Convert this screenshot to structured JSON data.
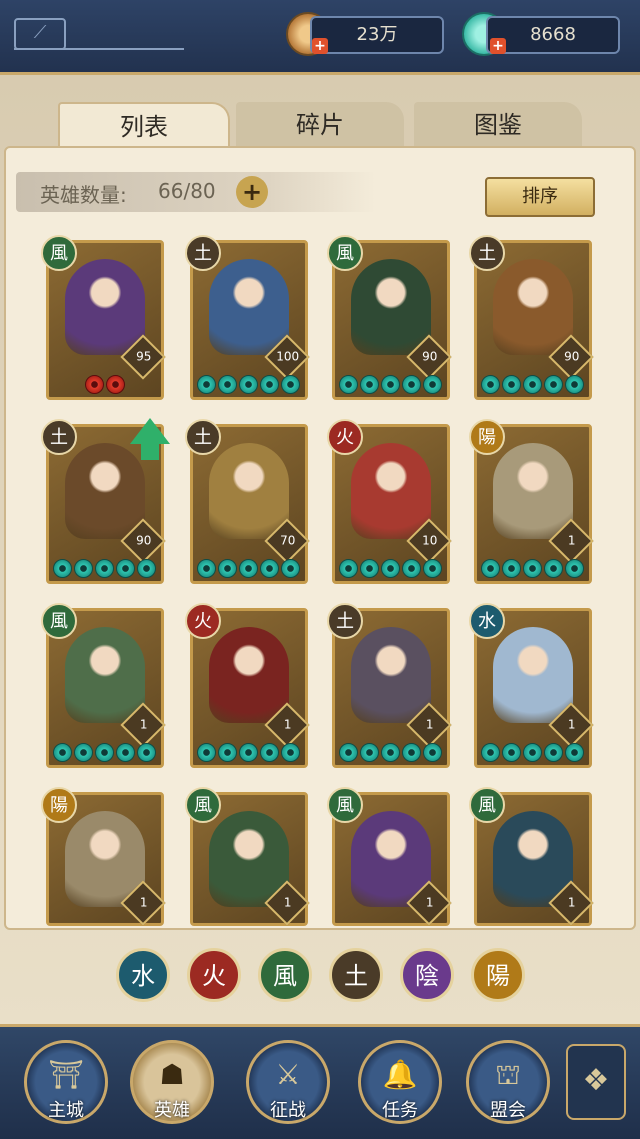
{
  "currency": {
    "coins": "23万",
    "gems": "8668"
  },
  "tabs": [
    {
      "label": "列表"
    },
    {
      "label": "碎片"
    },
    {
      "label": "图鉴"
    }
  ],
  "hero_count": {
    "label": "英雄数量:",
    "value": "66/80"
  },
  "sort_label": "排序",
  "elements": {
    "water": "水",
    "fire": "火",
    "wind": "風",
    "earth": "土",
    "yin": "陰",
    "yang": "陽"
  },
  "colors": {
    "water": "#1d5b6e",
    "fire": "#9c2a22",
    "wind": "#2f6a3b",
    "earth": "#4a3b28",
    "yin": "#6a3a8c",
    "yang": "#b07a18"
  },
  "heroes": [
    {
      "element": "風",
      "level": "95",
      "stars": 2,
      "red": true
    },
    {
      "element": "土",
      "level": "100",
      "stars": 5,
      "red": false
    },
    {
      "element": "風",
      "level": "90",
      "stars": 5,
      "red": false
    },
    {
      "element": "土",
      "level": "90",
      "stars": 5,
      "red": false
    },
    {
      "element": "土",
      "level": "90",
      "stars": 5,
      "red": false
    },
    {
      "element": "土",
      "level": "70",
      "stars": 5,
      "red": false
    },
    {
      "element": "火",
      "level": "10",
      "stars": 5,
      "red": false
    },
    {
      "element": "陽",
      "level": "1",
      "stars": 5,
      "red": false
    },
    {
      "element": "風",
      "level": "1",
      "stars": 5,
      "red": false
    },
    {
      "element": "火",
      "level": "1",
      "stars": 5,
      "red": false
    },
    {
      "element": "土",
      "level": "1",
      "stars": 5,
      "red": false
    },
    {
      "element": "水",
      "level": "1",
      "stars": 5,
      "red": false
    },
    {
      "element": "陽",
      "level": "1",
      "stars": 0,
      "red": false
    },
    {
      "element": "風",
      "level": "1",
      "stars": 0,
      "red": false
    },
    {
      "element": "風",
      "level": "1",
      "stars": 0,
      "red": false
    },
    {
      "element": "風",
      "level": "1",
      "stars": 0,
      "red": false
    }
  ],
  "nav": [
    {
      "label": "主城"
    },
    {
      "label": "英雄"
    },
    {
      "label": "征战"
    },
    {
      "label": "任务"
    },
    {
      "label": "盟会"
    }
  ]
}
